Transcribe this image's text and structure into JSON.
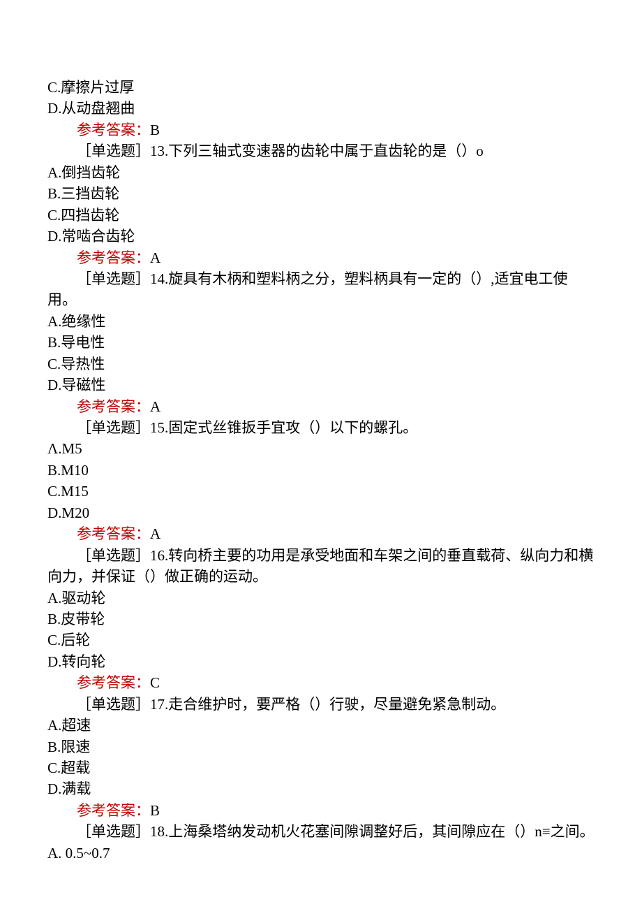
{
  "items": [
    {
      "kind": "option",
      "text": "C.摩擦片过厚"
    },
    {
      "kind": "option",
      "text": "D.从动盘翘曲"
    },
    {
      "kind": "answer",
      "label": "参考答案：",
      "value": "B"
    },
    {
      "kind": "question",
      "text": "［单选题］13.下列三轴式变速器的齿轮中属于直齿轮的是（）o"
    },
    {
      "kind": "option",
      "text": "A.倒挡齿轮"
    },
    {
      "kind": "option",
      "text": "B.三挡齿轮"
    },
    {
      "kind": "option",
      "text": "C.四挡齿轮"
    },
    {
      "kind": "option",
      "text": "D.常啮合齿轮"
    },
    {
      "kind": "answer",
      "label": "参考答案：",
      "value": "A"
    },
    {
      "kind": "question",
      "text": "［单选题］14.旋具有木柄和塑料柄之分，塑料柄具有一定的（）,适宜电工使用。"
    },
    {
      "kind": "option",
      "text": "A.绝缘性"
    },
    {
      "kind": "option",
      "text": "B.导电性"
    },
    {
      "kind": "option",
      "text": "C.导热性"
    },
    {
      "kind": "option",
      "text": "D.导磁性"
    },
    {
      "kind": "answer",
      "label": "参考答案：",
      "value": "A"
    },
    {
      "kind": "question",
      "text": "［单选题］15.固定式丝锥扳手宜攻（）以下的螺孔。"
    },
    {
      "kind": "option",
      "text": "Λ.M5"
    },
    {
      "kind": "option",
      "text": "B.M10"
    },
    {
      "kind": "option",
      "text": "C.M15"
    },
    {
      "kind": "option",
      "text": "D.M20"
    },
    {
      "kind": "answer",
      "label": "参考答案：",
      "value": "A"
    },
    {
      "kind": "question",
      "text": "［单选题］16.转向桥主要的功用是承受地面和车架之间的垂直载荷、纵向力和横向力，并保证（）做正确的运动。"
    },
    {
      "kind": "option",
      "text": "A.驱动轮"
    },
    {
      "kind": "option",
      "text": "B.皮带轮"
    },
    {
      "kind": "option",
      "text": "C.后轮"
    },
    {
      "kind": "option",
      "text": "D.转向轮"
    },
    {
      "kind": "answer",
      "label": "参考答案：",
      "value": "C"
    },
    {
      "kind": "question",
      "text": "［单选题］17.走合维护时，要严格（）行驶，尽量避免紧急制动。"
    },
    {
      "kind": "option",
      "text": "A.超速"
    },
    {
      "kind": "option",
      "text": "B.限速"
    },
    {
      "kind": "option",
      "text": "C.超载"
    },
    {
      "kind": "option",
      "text": "D.满载"
    },
    {
      "kind": "answer",
      "label": "参考答案：",
      "value": "B"
    },
    {
      "kind": "question",
      "text": "［单选题］18.上海桑塔纳发动机火花塞间隙调整好后，其间隙应在（）n≡之间。"
    },
    {
      "kind": "option",
      "text": "A. 0.5~0.7"
    }
  ]
}
